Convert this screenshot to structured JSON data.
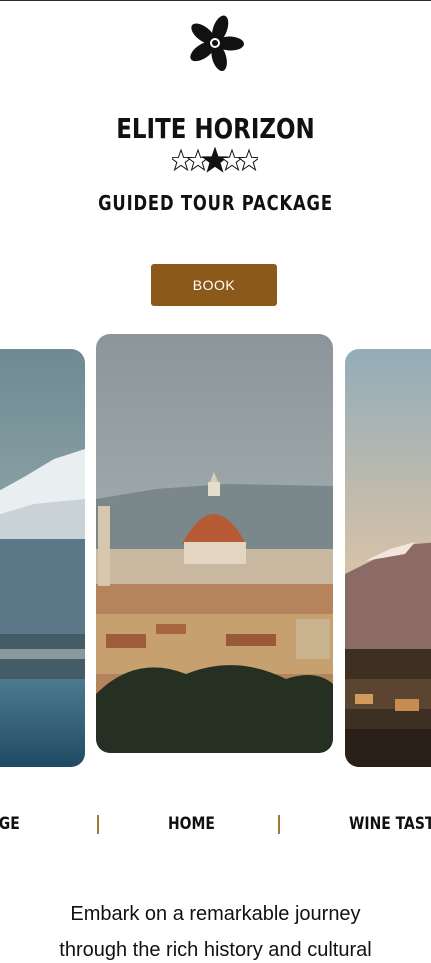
{
  "brand": {
    "title": "ELITE HORIZON",
    "rating": 3,
    "rating_max": 5,
    "subtitle": "GUIDED TOUR PACKAGE"
  },
  "book_button": {
    "label": "BOOK",
    "color": "#8b5a1a"
  },
  "carousel": {
    "cards": [
      {
        "name": "snowy-mountain-coast-photo"
      },
      {
        "name": "florence-duomo-photo"
      },
      {
        "name": "mountain-sunset-village-photo"
      }
    ]
  },
  "nav": {
    "items": [
      {
        "label": "AGE"
      },
      {
        "label": "HOME"
      },
      {
        "label": "WINE TASTI"
      }
    ],
    "separator_color": "#a07a3c"
  },
  "description": {
    "line1": "Embark on a remarkable journey",
    "line2": "through the rich history and cultural"
  },
  "icons": {
    "logo": "pinwheel-flower-icon",
    "rating": "star-icon"
  }
}
